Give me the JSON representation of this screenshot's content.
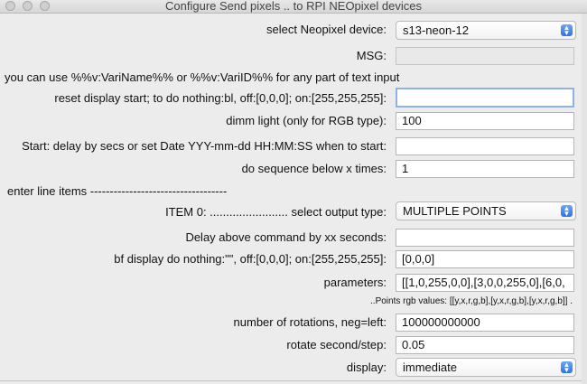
{
  "window": {
    "title": "Configure Send pixels ..  to  RPI NEOpixel devices"
  },
  "rows": {
    "device": {
      "label": "select Neopixel device:",
      "value": "s13-neon-12"
    },
    "msg": {
      "label": "MSG:",
      "value": ""
    },
    "hint": "you can use %%v:VariName%% or %%v:VariID%%  for any part of text input",
    "reset": {
      "label": "reset display start;  to do nothing:bl, off:[0,0,0]; on:[255,255,255]:",
      "value": ""
    },
    "dimm": {
      "label": "dimm light (only for RGB type):",
      "value": "100"
    },
    "start": {
      "label": "Start: delay by secs or set Date YYY-mm-dd HH:MM:SS when to start:",
      "value": ""
    },
    "sequence": {
      "label": "do sequence below x times:",
      "value": "1"
    },
    "separator": "enter line items -----------------------------------",
    "item": {
      "label": "ITEM     0:  ........................ select output type:",
      "value": "MULTIPLE POINTS"
    },
    "delay": {
      "label": "Delay above command by xx seconds:",
      "value": ""
    },
    "bf": {
      "label": "bf display do nothing:\"\", off:[0,0,0]; on:[255,255,255]:",
      "value": "[0,0,0]"
    },
    "params": {
      "label": "parameters:",
      "value": "[[1,0,255,0,0],[3,0,0,255,0],[6,0,"
    },
    "points_hint": "..Points rgb values: [[y,x,r,g,b],[y,x,r,g,b],[y,x,r,g,b]]   .",
    "rotations": {
      "label": "number of rotations, neg=left:",
      "value": "100000000000"
    },
    "rotate": {
      "label": "rotate second/step:",
      "value": "0.05"
    },
    "display": {
      "label": "display:",
      "value": "immediate"
    }
  },
  "icons": {
    "chevron": "updown-chevron-icon"
  }
}
